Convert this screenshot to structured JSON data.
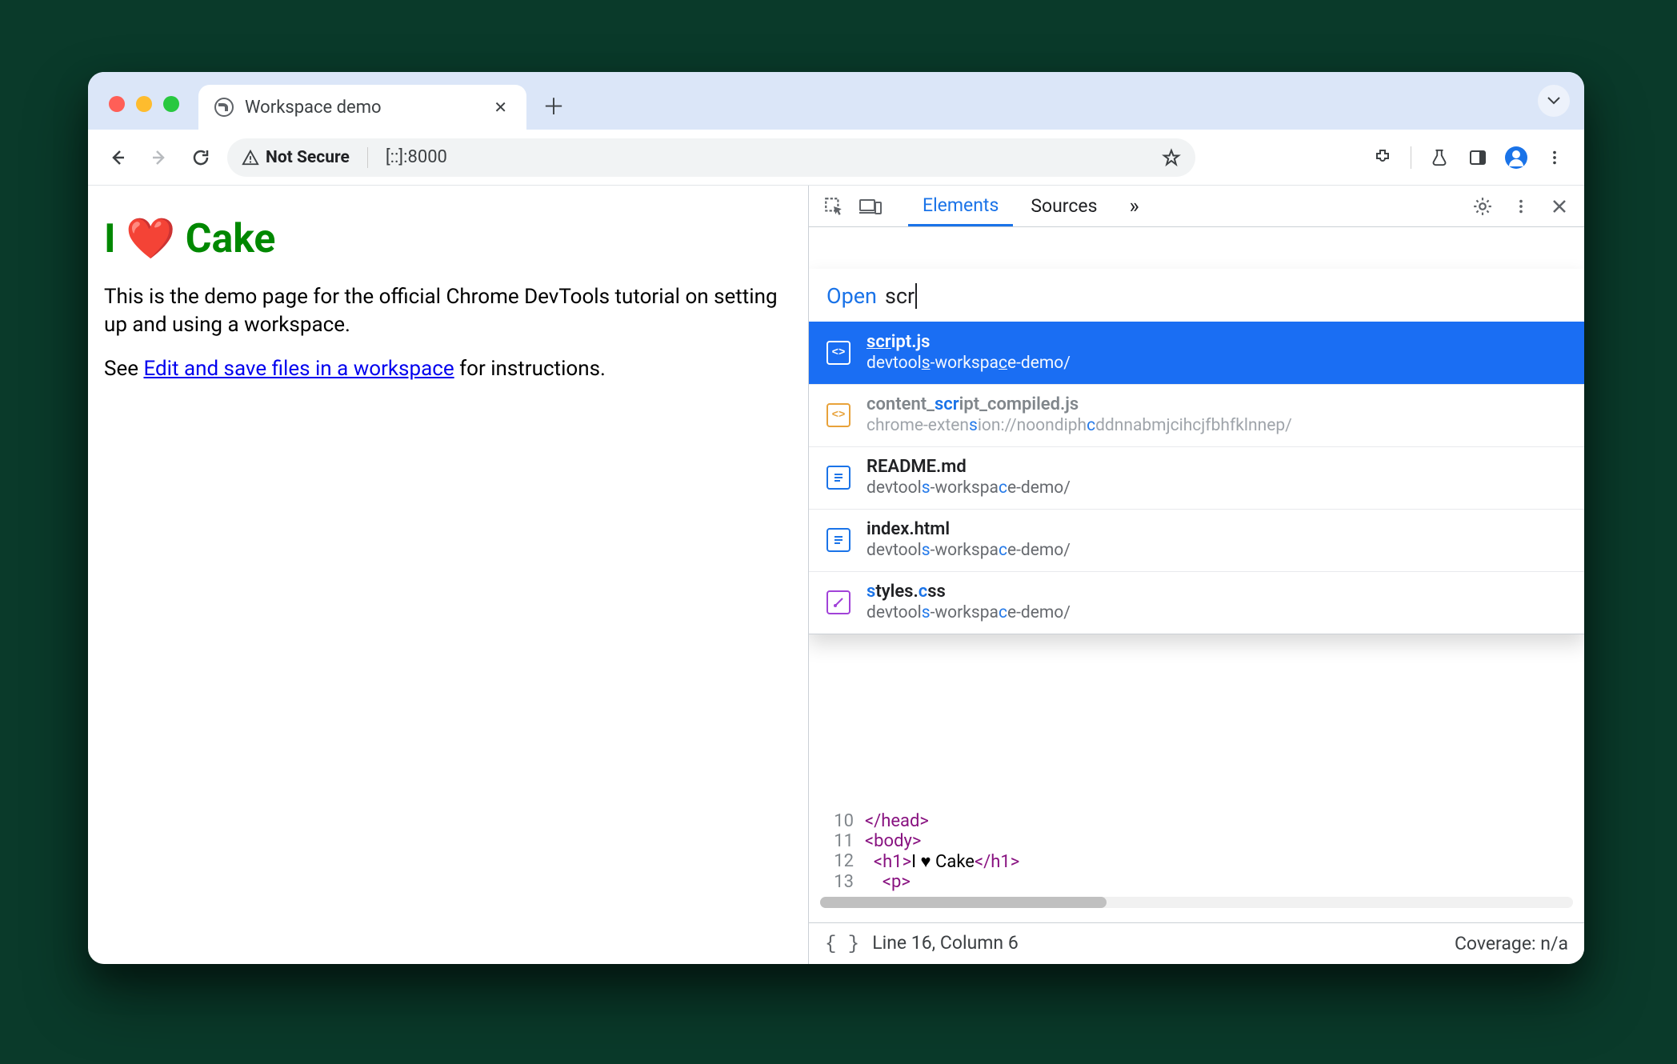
{
  "window": {
    "tab_title": "Workspace demo",
    "security_label": "Not Secure",
    "url": "[::]:8000"
  },
  "page": {
    "heading": "I ❤️ Cake",
    "para1": "This is the demo page for the official Chrome DevTools tutorial on setting up and using a workspace.",
    "para2_pre": "See ",
    "para2_link": "Edit and save files in a workspace",
    "para2_post": " for instructions."
  },
  "devtools": {
    "tabs": {
      "elements": "Elements",
      "sources": "Sources",
      "more": "»"
    },
    "quickopen": {
      "label": "Open",
      "query": "scr",
      "items": [
        {
          "name": "script.js",
          "path": "devtools-workspace-demo/",
          "kind": "js",
          "selected": true
        },
        {
          "name": "content_script_compiled.js",
          "path": "chrome-extension://noondiphcddnnabmjcihcjfbhfklnnep/",
          "kind": "js-dim"
        },
        {
          "name": "README.md",
          "path": "devtools-workspace-demo/",
          "kind": "doc"
        },
        {
          "name": "index.html",
          "path": "devtools-workspace-demo/",
          "kind": "doc"
        },
        {
          "name": "styles.css",
          "path": "devtools-workspace-demo/",
          "kind": "css"
        }
      ]
    },
    "code": {
      "lines": [
        {
          "n": "10",
          "html": "</head>"
        },
        {
          "n": "11",
          "html": "<body>"
        },
        {
          "n": "12",
          "html": "  <h1>I ♥ Cake</h1>"
        },
        {
          "n": "13",
          "html": "    <p>"
        }
      ]
    },
    "status": {
      "left": "Line 16, Column 6",
      "right": "Coverage: n/a"
    }
  }
}
